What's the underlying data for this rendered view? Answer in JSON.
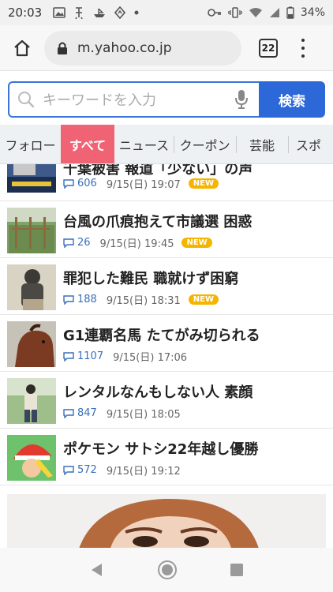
{
  "status_bar": {
    "time": "20:03",
    "battery_percent": "34%",
    "left_icons": [
      "photo-icon",
      "transit-icon",
      "boat-icon",
      "navigation-icon",
      "dot-icon"
    ],
    "right_icons": [
      "key-icon",
      "vibrate-icon",
      "wifi-icon",
      "signal-icon",
      "battery-icon"
    ]
  },
  "browser": {
    "url": "m.yahoo.co.jp",
    "tab_count": "22"
  },
  "search": {
    "placeholder": "キーワードを入力",
    "button_label": "検索"
  },
  "categories": [
    {
      "label": "フォロー",
      "active": false
    },
    {
      "label": "すべて",
      "active": true
    },
    {
      "label": "ニュース",
      "active": false
    },
    {
      "label": "クーポン",
      "active": false
    },
    {
      "label": "芸能",
      "active": false
    },
    {
      "label": "スポ",
      "active": false
    }
  ],
  "news": [
    {
      "title": "千葉被害 報道「少ない」の声",
      "comments": "606",
      "date": "9/15(日) 19:07",
      "badge": "NEW"
    },
    {
      "title": "台風の爪痕抱えて市議選 困惑",
      "comments": "26",
      "date": "9/15(日) 19:45",
      "badge": "NEW"
    },
    {
      "title": "罪犯した難民 職就けず困窮",
      "comments": "188",
      "date": "9/15(日) 18:31",
      "badge": "NEW"
    },
    {
      "title": "G1連覇名馬 たてがみ切られる",
      "comments": "1107",
      "date": "9/15(日) 17:06",
      "badge": ""
    },
    {
      "title": "レンタルなんもしない人 素顔",
      "comments": "847",
      "date": "9/15(日) 18:05",
      "badge": ""
    },
    {
      "title": "ポケモン サトシ22年越し優勝",
      "comments": "572",
      "date": "9/15(日) 19:12",
      "badge": ""
    }
  ],
  "colors": {
    "accent_blue": "#2d68d8",
    "active_tab": "#ef6375",
    "new_badge": "#f5b400",
    "comment_blue": "#3a6fb8"
  }
}
